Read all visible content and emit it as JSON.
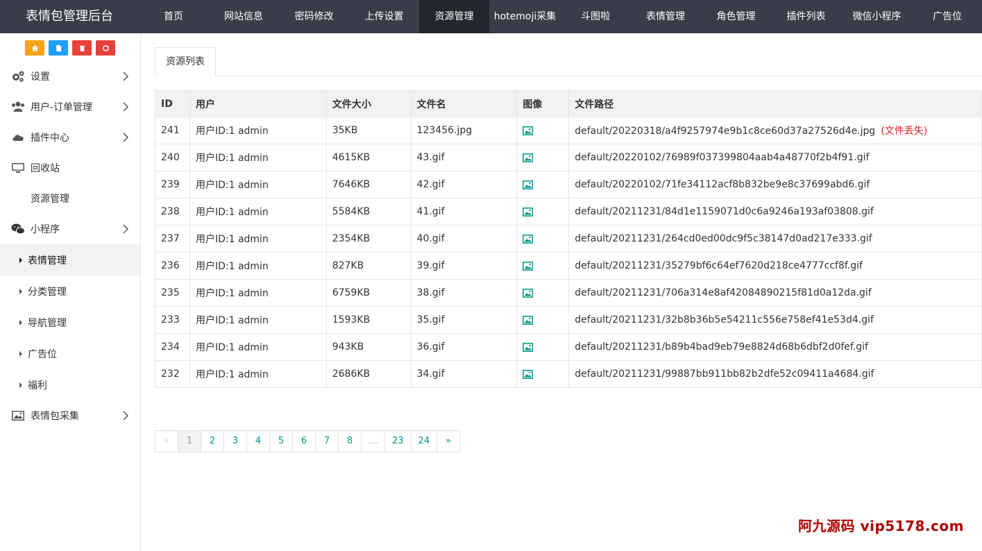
{
  "brand": "表情包管理后台",
  "topnav": [
    {
      "label": "首页",
      "active": false
    },
    {
      "label": "网站信息",
      "active": false
    },
    {
      "label": "密码修改",
      "active": false
    },
    {
      "label": "上传设置",
      "active": false
    },
    {
      "label": "资源管理",
      "active": true
    },
    {
      "label": "hotemoji采集",
      "active": false
    },
    {
      "label": "斗图啦",
      "active": false
    },
    {
      "label": "表情管理",
      "active": false
    },
    {
      "label": "角色管理",
      "active": false
    },
    {
      "label": "插件列表",
      "active": false
    },
    {
      "label": "微信小程序",
      "active": false
    },
    {
      "label": "广告位",
      "active": false
    }
  ],
  "quick_buttons": [
    {
      "icon": "home-icon",
      "color": "#f7a21b"
    },
    {
      "icon": "file-icon",
      "color": "#1e9fff"
    },
    {
      "icon": "trash-icon",
      "color": "#e8413b"
    },
    {
      "icon": "recycle-icon",
      "color": "#e8413b"
    }
  ],
  "sidebar": {
    "items": [
      {
        "label": "设置",
        "icon": "gears-icon",
        "has_arrow": true
      },
      {
        "label": "用户-订单管理",
        "icon": "users-icon",
        "has_arrow": true
      },
      {
        "label": "插件中心",
        "icon": "cloud-icon",
        "has_arrow": true
      },
      {
        "label": "回收站",
        "icon": "monitor-icon",
        "has_arrow": false
      },
      {
        "label": "资源管理",
        "icon": "file-icon",
        "has_arrow": false
      },
      {
        "label": "小程序",
        "icon": "wechat-icon",
        "has_arrow": true
      }
    ],
    "sub_items": [
      {
        "label": "表情管理",
        "active": true
      },
      {
        "label": "分类管理",
        "active": false
      },
      {
        "label": "导航管理",
        "active": false
      },
      {
        "label": "广告位",
        "active": false
      },
      {
        "label": "福利",
        "active": false
      }
    ],
    "last_item": {
      "label": "表情包采集",
      "icon": "image-icon",
      "has_arrow": true
    }
  },
  "tab_label": "资源列表",
  "table": {
    "headers": [
      "ID",
      "用户",
      "文件大小",
      "文件名",
      "图像",
      "文件路径"
    ],
    "lost_label": "(文件丢失)",
    "rows": [
      {
        "id": "241",
        "user": "用户ID:1 admin",
        "size": "35KB",
        "name": "123456.jpg",
        "path": "default/20220318/a4f9257974e9b1c8ce60d37a27526d4e.jpg",
        "lost": true
      },
      {
        "id": "240",
        "user": "用户ID:1 admin",
        "size": "4615KB",
        "name": "43.gif",
        "path": "default/20220102/76989f037399804aab4a48770f2b4f91.gif",
        "lost": false
      },
      {
        "id": "239",
        "user": "用户ID:1 admin",
        "size": "7646KB",
        "name": "42.gif",
        "path": "default/20220102/71fe34112acf8b832be9e8c37699abd6.gif",
        "lost": false
      },
      {
        "id": "238",
        "user": "用户ID:1 admin",
        "size": "5584KB",
        "name": "41.gif",
        "path": "default/20211231/84d1e1159071d0c6a9246a193af03808.gif",
        "lost": false
      },
      {
        "id": "237",
        "user": "用户ID:1 admin",
        "size": "2354KB",
        "name": "40.gif",
        "path": "default/20211231/264cd0ed00dc9f5c38147d0ad217e333.gif",
        "lost": false
      },
      {
        "id": "236",
        "user": "用户ID:1 admin",
        "size": "827KB",
        "name": "39.gif",
        "path": "default/20211231/35279bf6c64ef7620d218ce4777ccf8f.gif",
        "lost": false
      },
      {
        "id": "235",
        "user": "用户ID:1 admin",
        "size": "6759KB",
        "name": "38.gif",
        "path": "default/20211231/706a314e8af42084890215f81d0a12da.gif",
        "lost": false
      },
      {
        "id": "233",
        "user": "用户ID:1 admin",
        "size": "1593KB",
        "name": "35.gif",
        "path": "default/20211231/32b8b36b5e54211c556e758ef41e53d4.gif",
        "lost": false
      },
      {
        "id": "234",
        "user": "用户ID:1 admin",
        "size": "943KB",
        "name": "36.gif",
        "path": "default/20211231/b89b4bad9eb79e8824d68b6dbf2d0fef.gif",
        "lost": false
      },
      {
        "id": "232",
        "user": "用户ID:1 admin",
        "size": "2686KB",
        "name": "34.gif",
        "path": "default/20211231/99887bb911bb82b2dfe52c09411a4684.gif",
        "lost": false
      }
    ]
  },
  "pagination": [
    "«",
    "1",
    "2",
    "3",
    "4",
    "5",
    "6",
    "7",
    "8",
    "…",
    "23",
    "24",
    "»"
  ],
  "pagination_current": "1",
  "watermark": "阿九源码 vip5178.com",
  "colors": {
    "topbar": "#393d49",
    "active_nav": "#22262e",
    "image_icon": "#009688",
    "lost": "#e02020"
  }
}
